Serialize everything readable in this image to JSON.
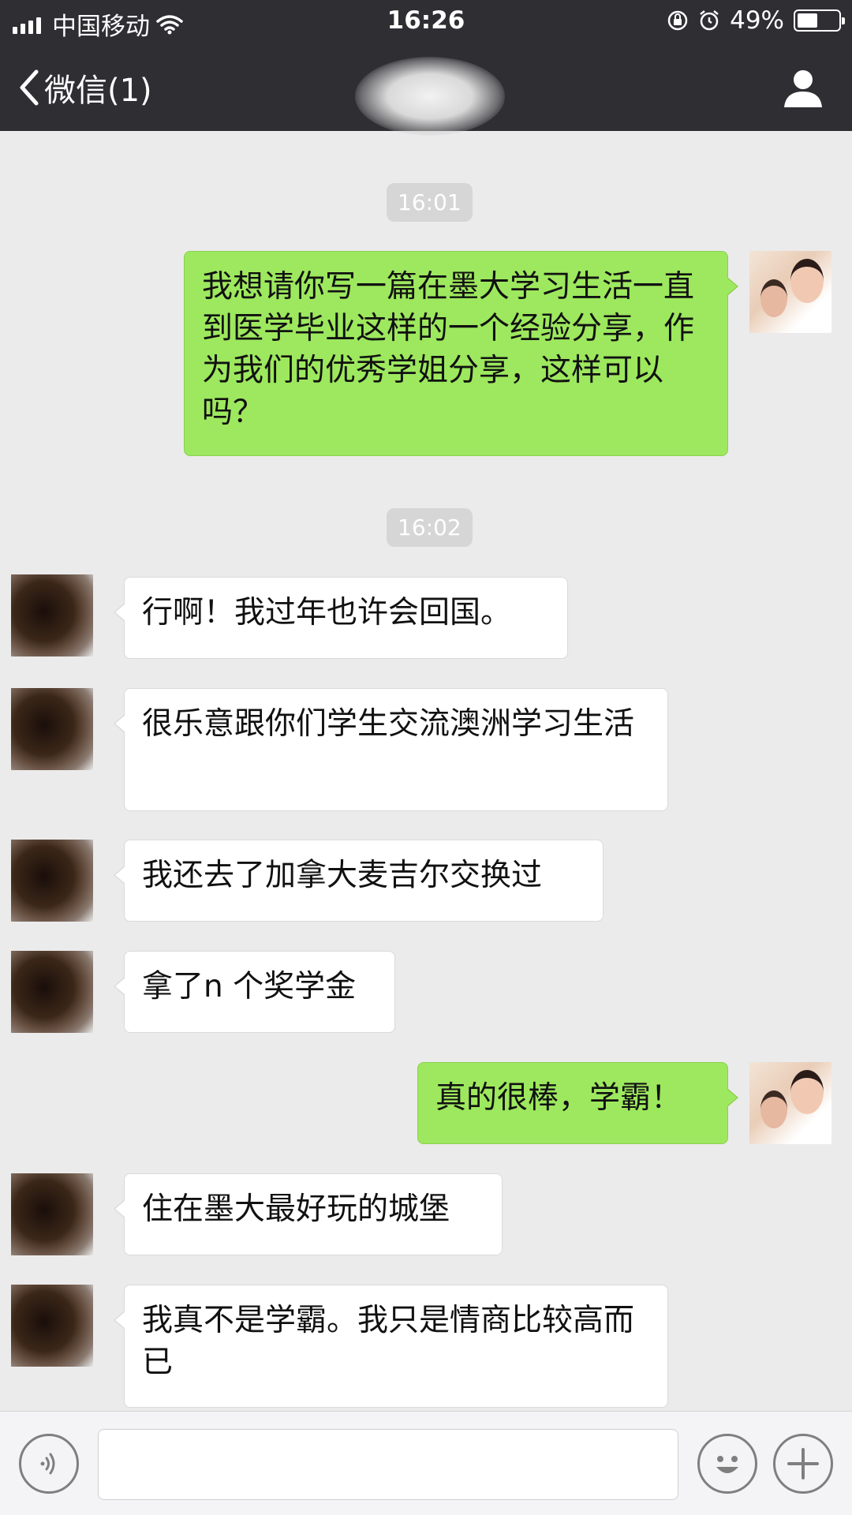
{
  "status_bar": {
    "carrier": "中国移动",
    "time": "16:26",
    "battery": "49%",
    "battery_level": 0.49
  },
  "header": {
    "back_label": "微信(1)"
  },
  "timestamps": [
    "16:01",
    "16:02"
  ],
  "messages": [
    {
      "side": "out",
      "text": "我想请你写一篇在墨大学习生活一直到医学毕业这样的一个经验分享，作为我们的优秀学姐分享，这样可以吗？"
    },
    {
      "side": "in",
      "text": "行啊！我过年也许会回国。"
    },
    {
      "side": "in",
      "text": "很乐意跟你们学生交流澳洲学习生活"
    },
    {
      "side": "in",
      "text": "我还去了加拿大麦吉尔交换过"
    },
    {
      "side": "in",
      "text": "拿了n 个奖学金"
    },
    {
      "side": "out",
      "text": "真的很棒，学霸！"
    },
    {
      "side": "in",
      "text": "住在墨大最好玩的城堡"
    },
    {
      "side": "in",
      "text": "我真不是学霸。我只是情商比较高而已"
    }
  ],
  "input": {
    "value": "",
    "placeholder": ""
  },
  "colors": {
    "header_bg": "#2e2e33",
    "chat_bg": "#ebebeb",
    "outgoing_bubble": "#9de85e",
    "incoming_bubble": "#ffffff"
  }
}
